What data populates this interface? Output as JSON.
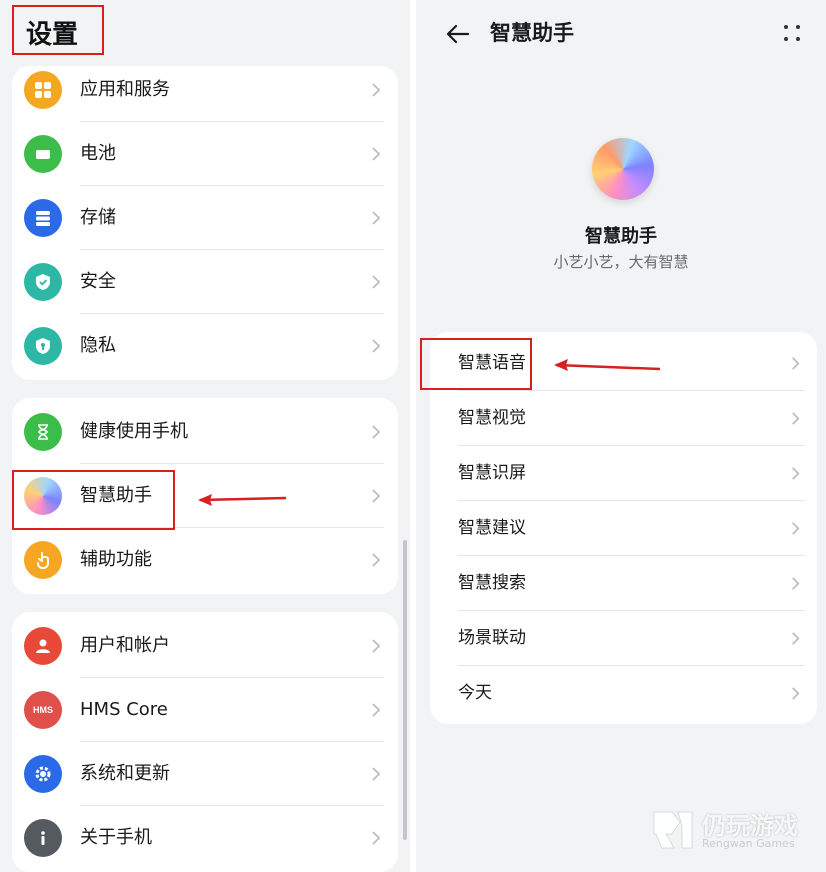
{
  "left": {
    "title": "设置",
    "group1": [
      {
        "label": "应用和服务",
        "icon": "apps-icon",
        "color": "#f5a623"
      },
      {
        "label": "电池",
        "icon": "battery-icon",
        "color": "#3cbd4a"
      },
      {
        "label": "存储",
        "icon": "storage-icon",
        "color": "#2a6ae6"
      },
      {
        "label": "安全",
        "icon": "shield-icon",
        "color": "#2db8a5"
      },
      {
        "label": "隐私",
        "icon": "privacy-lock-icon",
        "color": "#2db8a5"
      }
    ],
    "group2": [
      {
        "label": "健康使用手机",
        "icon": "hourglass-icon",
        "color": "#3cbd4a"
      },
      {
        "label": "智慧助手",
        "icon": "celia-assistant-icon",
        "color": "#f7a9c9"
      },
      {
        "label": "辅助功能",
        "icon": "accessibility-hand-icon",
        "color": "#f5a623"
      }
    ],
    "group3": [
      {
        "label": "用户和帐户",
        "icon": "user-icon",
        "color": "#e84a3a"
      },
      {
        "label": "HMS Core",
        "icon": "hms-icon",
        "color": "#e0504a",
        "icon_text": "HMS"
      },
      {
        "label": "系统和更新",
        "icon": "gear-icon",
        "color": "#2a6ae6"
      },
      {
        "label": "关于手机",
        "icon": "info-icon",
        "color": "#555a60"
      }
    ]
  },
  "right": {
    "title": "智慧助手",
    "hero_title": "智慧助手",
    "hero_subtitle": "小艺小艺，大有智慧",
    "items": [
      {
        "label": "智慧语音"
      },
      {
        "label": "智慧视觉"
      },
      {
        "label": "智慧识屏"
      },
      {
        "label": "智慧建议"
      },
      {
        "label": "智慧搜索"
      },
      {
        "label": "场景联动"
      },
      {
        "label": "今天"
      }
    ]
  },
  "watermark": {
    "name": "仍玩游戏",
    "sub": "Rengwan Games"
  },
  "colors": {
    "highlight_red": "#d8201e",
    "panel_bg": "#f1f3f5"
  }
}
